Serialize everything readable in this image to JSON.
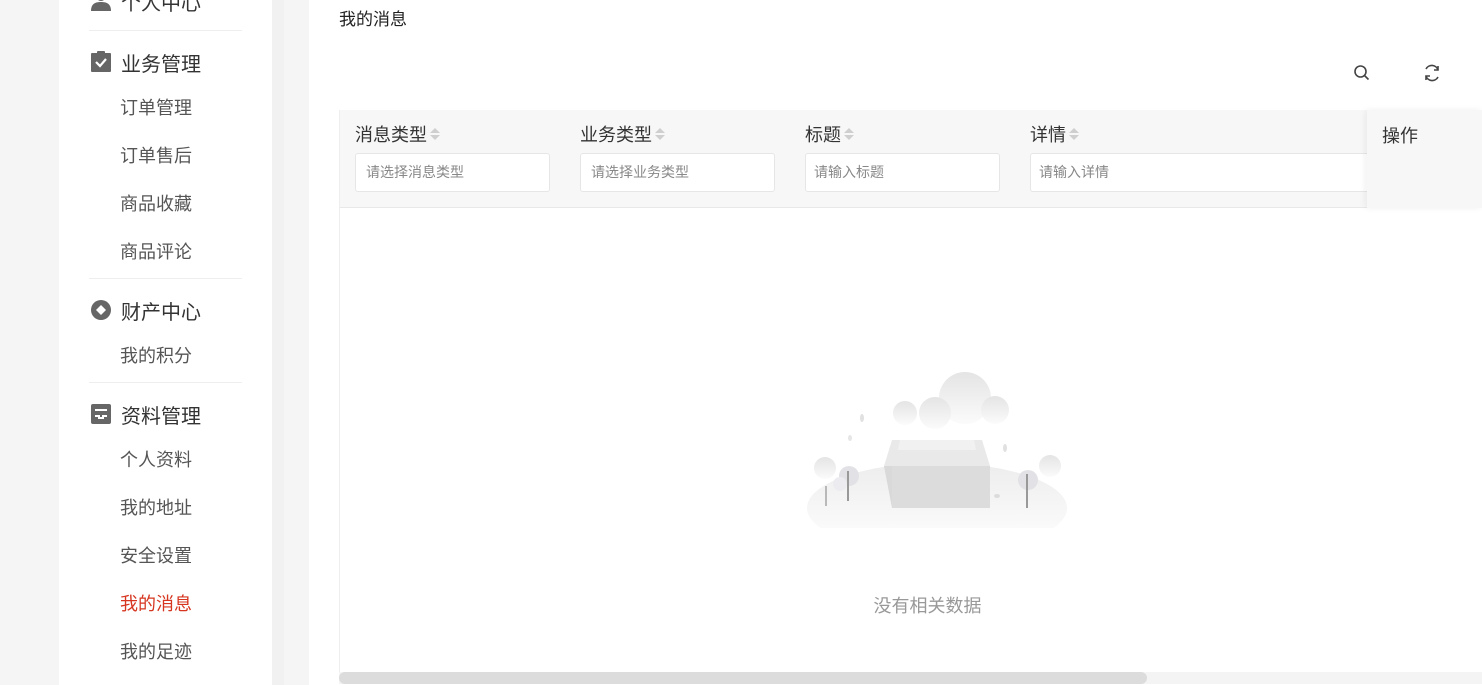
{
  "sidebar": {
    "groups": [
      {
        "title": "个人中心",
        "icon": "user-icon",
        "items": []
      },
      {
        "title": "业务管理",
        "icon": "clipboard-check-icon",
        "items": [
          "订单管理",
          "订单售后",
          "商品收藏",
          "商品评论"
        ]
      },
      {
        "title": "财产中心",
        "icon": "diamond-badge-icon",
        "items": [
          "我的积分"
        ]
      },
      {
        "title": "资料管理",
        "icon": "archive-icon",
        "items": [
          "个人资料",
          "我的地址",
          "安全设置",
          "我的消息",
          "我的足迹"
        ]
      }
    ],
    "active_item": "我的消息"
  },
  "page": {
    "title": "我的消息"
  },
  "toolbar": {
    "search_icon": "search-icon",
    "refresh_icon": "refresh-icon"
  },
  "table": {
    "columns": [
      {
        "label": "消息类型",
        "placeholder": "请选择消息类型"
      },
      {
        "label": "业务类型",
        "placeholder": "请选择业务类型"
      },
      {
        "label": "标题",
        "placeholder": "请输入标题"
      },
      {
        "label": "详情",
        "placeholder": "请输入详情"
      }
    ],
    "action_column": "操作",
    "empty_text": "没有相关数据"
  },
  "colors": {
    "accent": "#d6351f",
    "muted": "#999999"
  }
}
